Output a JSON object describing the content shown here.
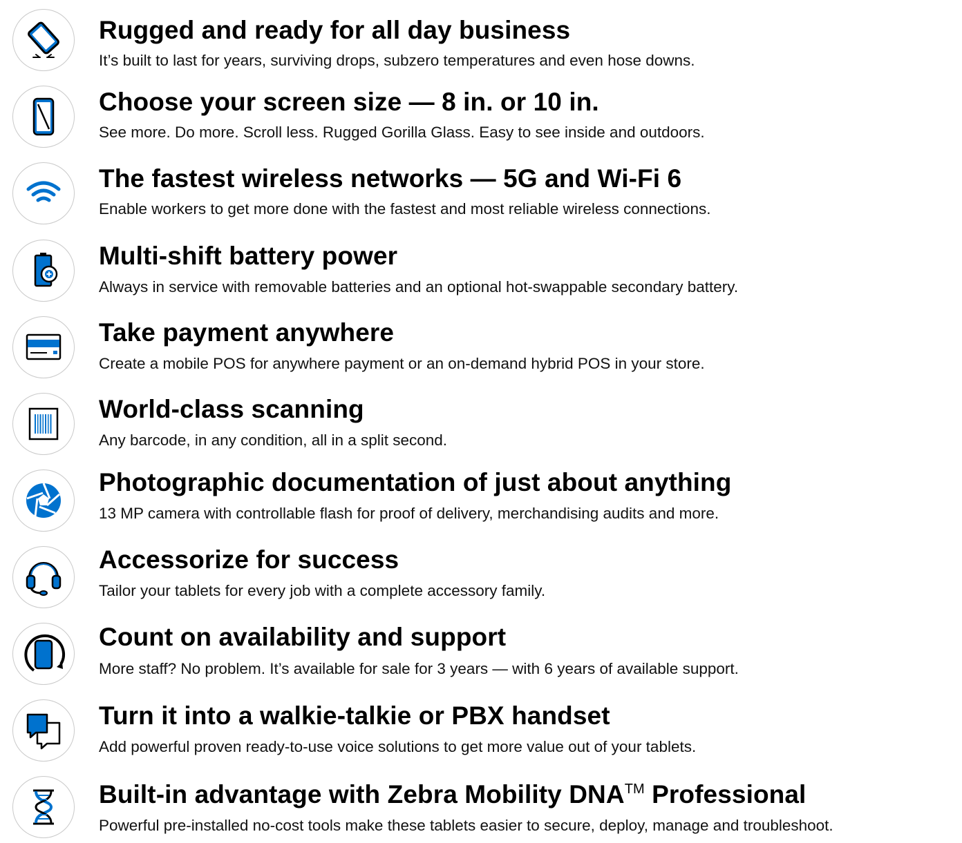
{
  "colors": {
    "accent": "#0072ce",
    "text": "#000000",
    "circle_border": "#c9c9c9"
  },
  "features": [
    {
      "icon": "rugged-tablet-drop-icon",
      "title": "Rugged and ready for all day business",
      "desc": "It’s built to last for years, surviving drops, subzero temperatures and even hose downs."
    },
    {
      "icon": "screen-size-icon",
      "title": "Choose your screen size — 8 in. or 10 in.",
      "desc": "See more. Do more. Scroll less. Rugged Gorilla Glass. Easy to see inside and outdoors."
    },
    {
      "icon": "wifi-icon",
      "title": "The fastest wireless networks — 5G and Wi-Fi 6",
      "desc": "Enable workers to get more done with the fastest and most reliable wireless connections."
    },
    {
      "icon": "battery-icon",
      "title": "Multi-shift battery power",
      "desc": "Always in service with removable batteries and an optional hot-swappable secondary battery."
    },
    {
      "icon": "payment-card-icon",
      "title": "Take payment anywhere",
      "desc": "Create a mobile POS for anywhere payment or an on-demand hybrid POS in your store."
    },
    {
      "icon": "barcode-scan-icon",
      "title": "World-class scanning",
      "desc": "Any barcode, in any condition, all in a split second."
    },
    {
      "icon": "camera-aperture-icon",
      "title": "Photographic documentation of just about anything",
      "desc": "13 MP camera with controllable flash for proof of delivery, merchandising audits and more."
    },
    {
      "icon": "headset-icon",
      "title": "Accessorize for success",
      "desc": "Tailor your tablets for every job with a complete accessory family."
    },
    {
      "icon": "device-lifecycle-icon",
      "title": "Count on availability and support",
      "desc": "More staff? No problem. It’s available for sale for 3 years — with 6 years of available support."
    },
    {
      "icon": "chat-bubbles-icon",
      "title": "Turn it into a walkie-talkie or PBX handset",
      "desc": "Add powerful proven ready-to-use voice solutions to get more value out of your tablets."
    },
    {
      "icon": "dna-icon",
      "title_pre": "Built-in advantage with Zebra Mobility DNA",
      "title_tm": "TM",
      "title_post": " Professional",
      "desc": "Powerful pre-installed no-cost tools make these tablets easier to secure, deploy, manage and troubleshoot."
    }
  ]
}
